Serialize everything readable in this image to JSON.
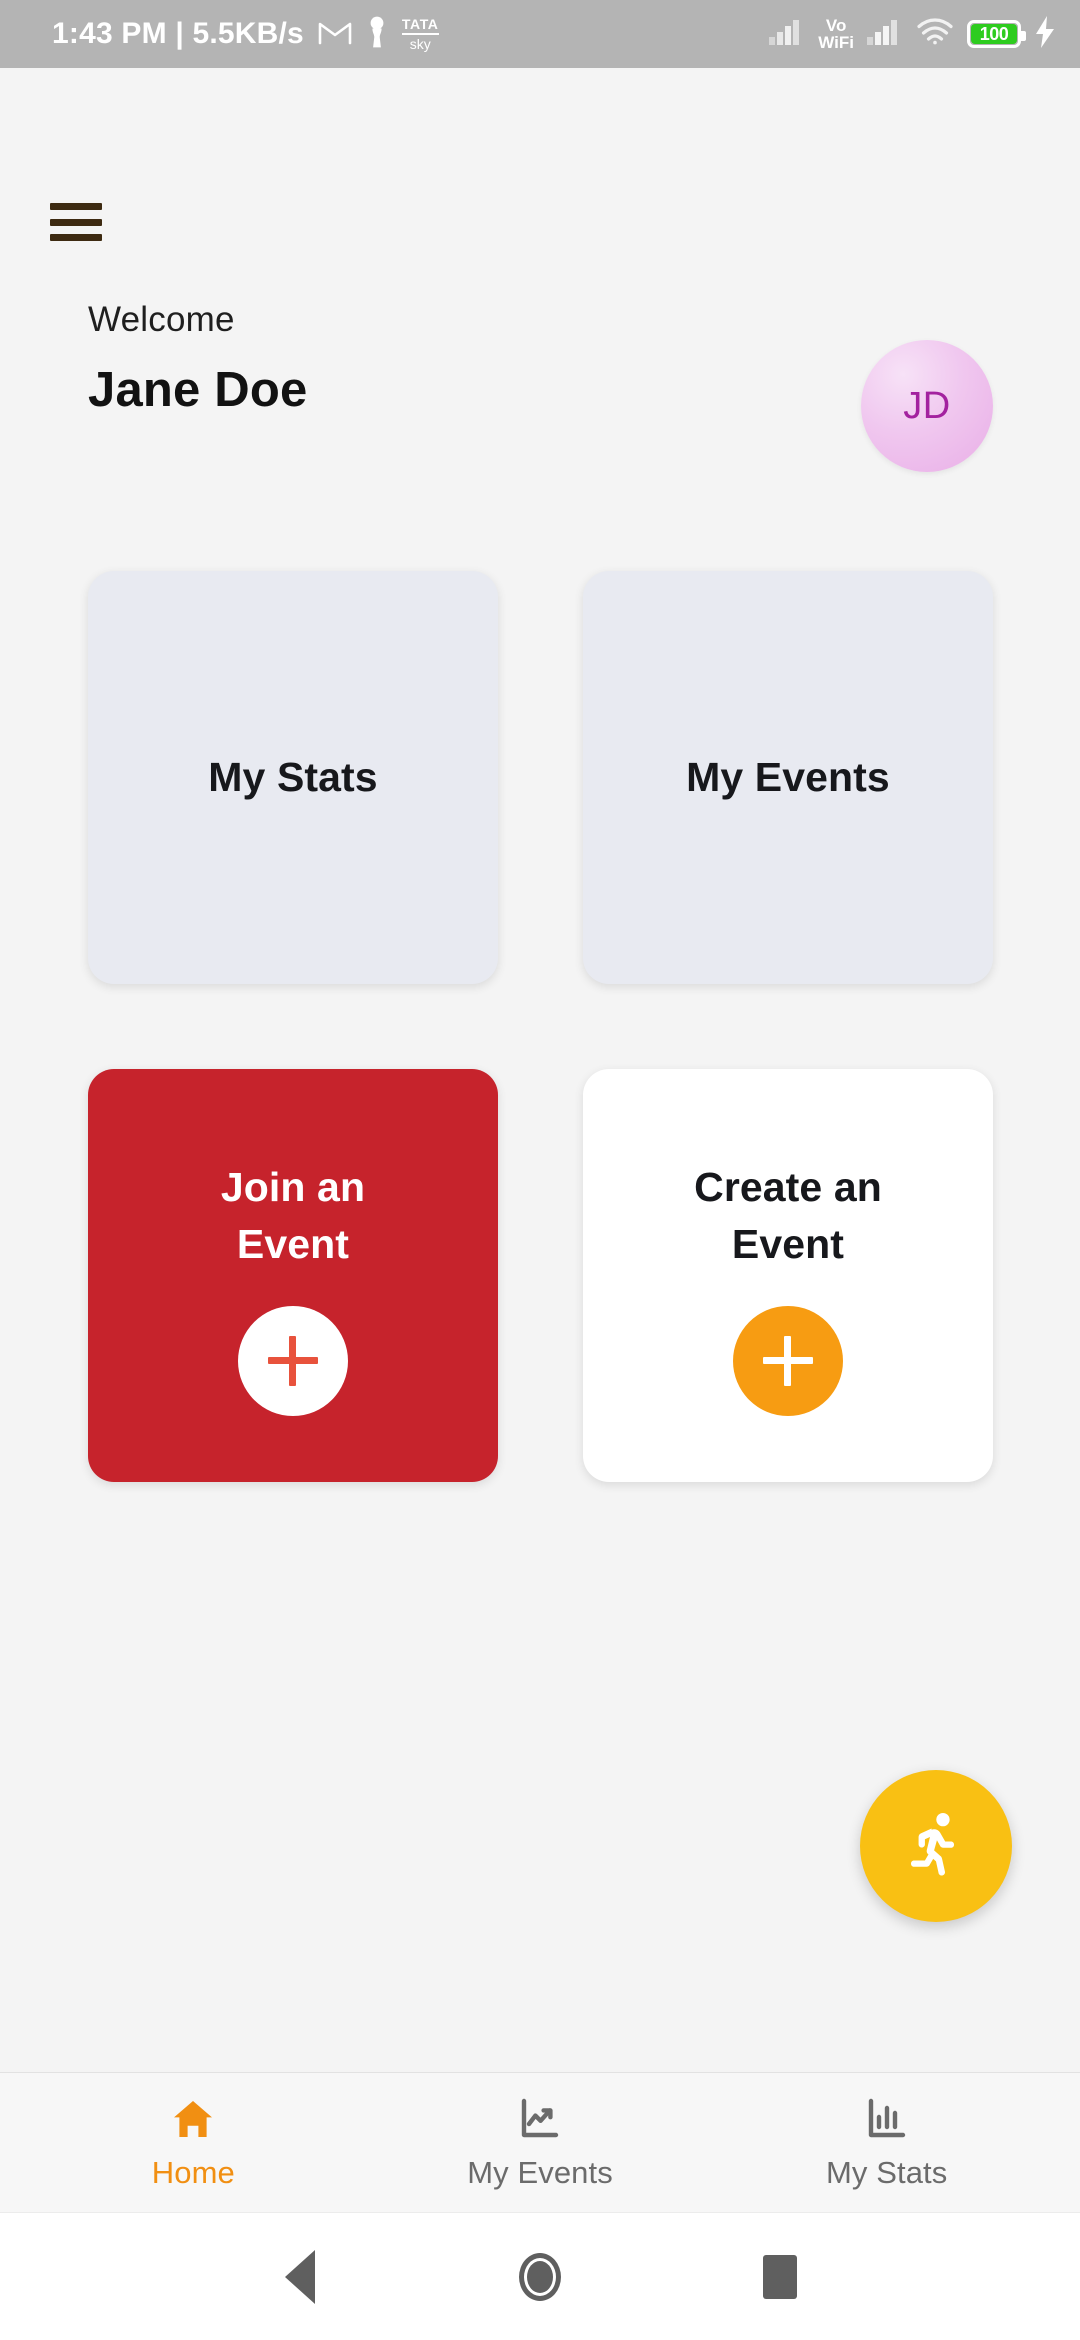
{
  "status_bar": {
    "clock": "1:43 PM | 5.5KB/s",
    "gmail_icon": "gmail-icon",
    "pawn_icon": "chess-pawn-icon",
    "tata_sky_top": "TATA",
    "tata_sky_bottom": "sky",
    "signal_icon": "cellular-signal-icon",
    "vo_line1": "Vo",
    "vo_line2": "WiFi",
    "signal2_icon": "cellular-signal-2-icon",
    "wifi_icon": "wifi-icon",
    "battery_percent": "100",
    "charging_icon": "charging-bolt-icon",
    "bg_color": "#b4b4b4"
  },
  "header": {
    "menu_icon": "hamburger-menu-icon",
    "welcome_text": "Welcome",
    "user_name": "Jane Doe",
    "avatar_initials": "JD",
    "avatar_text_color": "#a3229f"
  },
  "tiles": [
    {
      "label": "My Stats",
      "type": "plain",
      "bg_color": "#e8eaf1",
      "text_color": "#17181c",
      "name": "tile-my-stats"
    },
    {
      "label": "My Events",
      "type": "plain",
      "bg_color": "#e8eaf1",
      "text_color": "#17181c",
      "name": "tile-my-events"
    },
    {
      "label": "Join an Event",
      "line1": "Join an",
      "line2": "Event",
      "type": "action",
      "bg_color": "#c6232c",
      "text_color": "#ffffff",
      "circle_bg": "#ffffff",
      "plus_color": "#e8523c",
      "name": "tile-join-event"
    },
    {
      "label": "Create an Event",
      "line1": "Create an",
      "line2": "Event",
      "type": "action",
      "bg_color": "#ffffff",
      "text_color": "#17181c",
      "circle_bg": "#f79c12",
      "plus_color": "#ffffff",
      "name": "tile-create-event"
    }
  ],
  "fab": {
    "icon": "running-person-icon",
    "bg_color": "#f9c013",
    "icon_color": "#ffffff"
  },
  "bottom_nav": {
    "active_color": "#f18f12",
    "inactive_color": "#6b6b6b",
    "items": [
      {
        "label": "Home",
        "icon": "home-icon",
        "active": true
      },
      {
        "label": "My Events",
        "icon": "line-chart-icon",
        "active": false
      },
      {
        "label": "My Stats",
        "icon": "bar-chart-icon",
        "active": false
      }
    ]
  },
  "system_nav": {
    "back_icon": "back-triangle-icon",
    "home_icon": "home-circle-icon",
    "recents_icon": "recents-square-icon"
  }
}
